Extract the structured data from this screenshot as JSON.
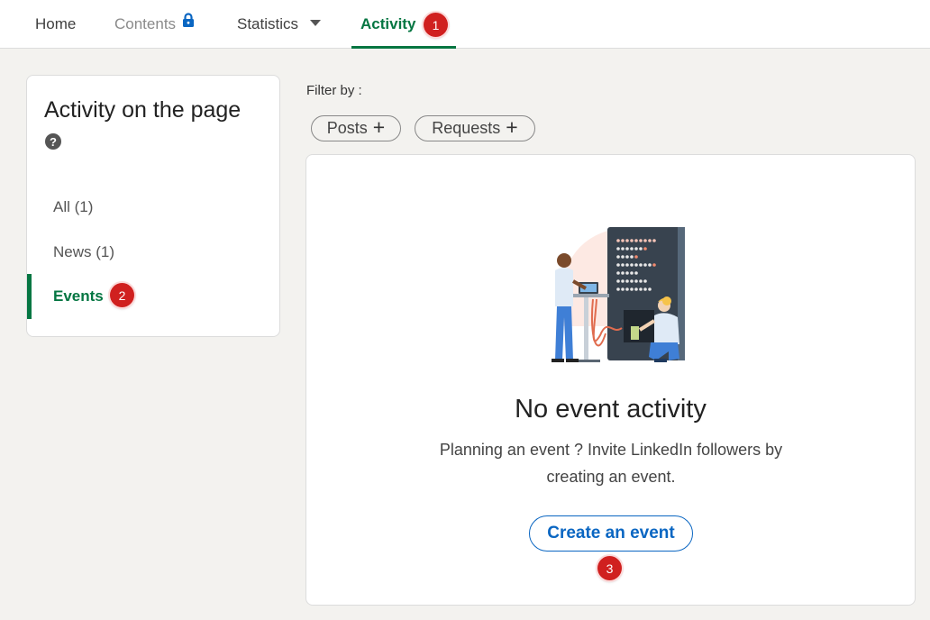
{
  "nav": {
    "tabs": [
      {
        "label": "Home",
        "icon": null
      },
      {
        "label": "Contents",
        "icon": "lock-icon"
      },
      {
        "label": "Statistics",
        "icon": "caret-down-icon"
      },
      {
        "label": "Activity",
        "icon": null
      }
    ],
    "active_tab": "Activity",
    "badge": "1"
  },
  "sidebar": {
    "title": "Activity on the page",
    "help_icon": "?",
    "items": [
      {
        "label": "All (1)"
      },
      {
        "label": "News (1)"
      },
      {
        "label": "Events"
      }
    ],
    "active_item": "Events",
    "badge": "2"
  },
  "filter": {
    "label": "Filter by :",
    "pills": [
      {
        "label": "Posts",
        "icon": "+"
      },
      {
        "label": "Requests",
        "icon": "+"
      }
    ]
  },
  "main": {
    "illustration": "people-with-server-rack-illustration",
    "title": "No event activity",
    "description": "Planning an event ? Invite LinkedIn followers by creating an event.",
    "cta": "Create an event",
    "badge": "3"
  },
  "colors": {
    "accent_green": "#057642",
    "link_blue": "#0a66c2",
    "badge_red": "#d0201f",
    "background": "#f3f2ef"
  }
}
